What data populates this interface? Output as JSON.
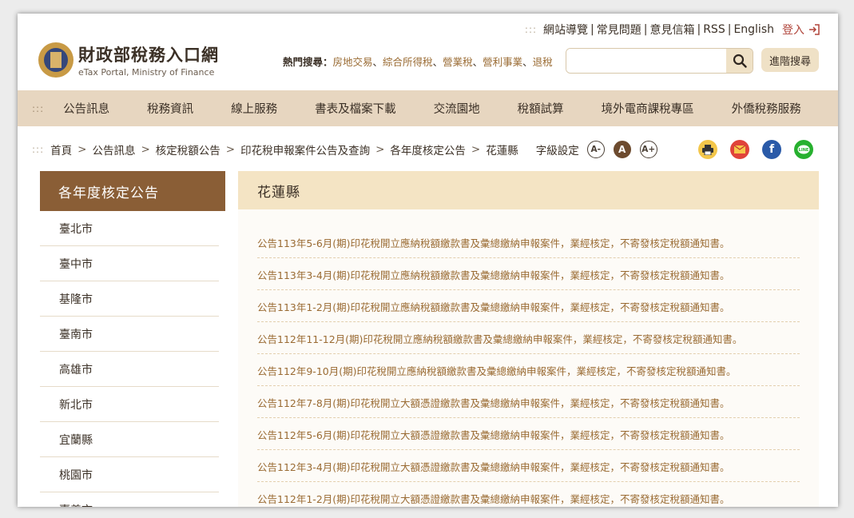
{
  "topbar": {
    "links": [
      "網站導覽",
      "常見問題",
      "意見信箱",
      "RSS",
      "English"
    ],
    "login": "登入"
  },
  "logo": {
    "zh": "財政部稅務入口網",
    "en": "eTax Portal, Ministry of Finance"
  },
  "hot_search": {
    "label": "熱門搜尋：",
    "terms": [
      "房地交易",
      "綜合所得稅",
      "營業稅",
      "營利事業",
      "退稅"
    ]
  },
  "search": {
    "placeholder": "",
    "advanced": "進階搜尋"
  },
  "nav": [
    "公告訊息",
    "稅務資訊",
    "線上服務",
    "書表及檔案下載",
    "交流園地",
    "稅額試算",
    "境外電商課稅專區",
    "外僑稅務服務"
  ],
  "breadcrumb": [
    "首頁",
    "公告訊息",
    "核定稅額公告",
    "印花稅申報案件公告及查詢",
    "各年度核定公告",
    "花蓮縣"
  ],
  "font_setting": {
    "label": "字級設定",
    "small": "A-",
    "normal": "A",
    "large": "A+"
  },
  "sidebar": {
    "title": "各年度核定公告",
    "items": [
      "臺北市",
      "臺中市",
      "基隆市",
      "臺南市",
      "高雄市",
      "新北市",
      "宜蘭縣",
      "桃園市",
      "嘉義市"
    ]
  },
  "main": {
    "title": "花蓮縣",
    "announcements": [
      "公告113年5-6月(期)印花稅開立應納稅額繳款書及彙總繳納申報案件，業經核定，不寄發核定稅額通知書。",
      "公告113年3-4月(期)印花稅開立應納稅額繳款書及彙總繳納申報案件，業經核定，不寄發核定稅額通知書。",
      "公告113年1-2月(期)印花稅開立應納稅額繳款書及彙總繳納申報案件，業經核定，不寄發核定稅額通知書。",
      "公告112年11-12月(期)印花稅開立應納稅額繳款書及彙總繳納申報案件，業經核定，不寄發核定稅額通知書。",
      "公告112年9-10月(期)印花稅開立應納稅額繳款書及彙總繳納申報案件，業經核定，不寄發核定稅額通知書。",
      "公告112年7-8月(期)印花稅開立大額憑證繳款書及彙總繳納申報案件，業經核定，不寄發核定稅額通知書。",
      "公告112年5-6月(期)印花稅開立大額憑證繳款書及彙總繳納申報案件，業經核定，不寄發核定稅額通知書。",
      "公告112年3-4月(期)印花稅開立大額憑證繳款書及彙總繳納申報案件，業經核定，不寄發核定稅額通知書。",
      "公告112年1-2月(期)印花稅開立大額憑證繳款書及彙總繳納申報案件，業經核定，不寄發核定稅額通知書。"
    ]
  },
  "share_icons": [
    "print-icon",
    "email-icon",
    "facebook-icon",
    "line-icon"
  ],
  "colors": {
    "brand_brown": "#8a5e36",
    "nav_bg": "#e7d6c0",
    "title_bg": "#f4e4c4",
    "link": "#9a6b33",
    "login_red": "#b0443a"
  }
}
